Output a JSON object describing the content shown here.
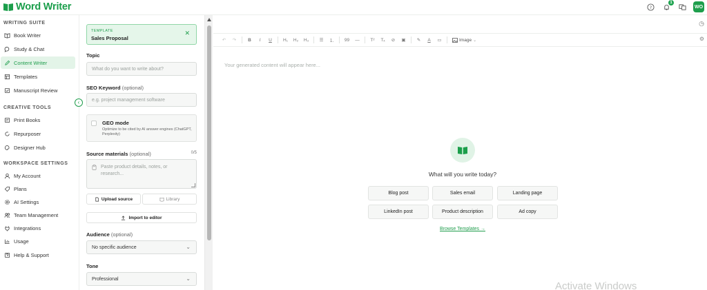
{
  "app": {
    "name": "Word Writer"
  },
  "topbar": {
    "notification_count": "1",
    "avatar_initials": "WO"
  },
  "sidebar": {
    "sections": [
      {
        "title": "WRITING SUITE",
        "items": [
          "Book Writer",
          "Study & Chat",
          "Content Writer",
          "Templates",
          "Manuscript Review"
        ]
      },
      {
        "title": "CREATIVE TOOLS",
        "items": [
          "Print Books",
          "Repurposer",
          "Designer Hub"
        ]
      },
      {
        "title": "WORKSPACE SETTINGS",
        "items": [
          "My Account",
          "Plans",
          "AI Settings",
          "Team Management",
          "Integrations",
          "Usage",
          "Help & Support"
        ]
      }
    ],
    "active_item": "Content Writer"
  },
  "form": {
    "template": {
      "label": "TEMPLATE",
      "name": "Sales Proposal"
    },
    "topic": {
      "label": "Topic",
      "placeholder": "What do you want to write about?"
    },
    "seo": {
      "label": "SEO Keyword",
      "optional": "(optional)",
      "placeholder": "e.g. project management software"
    },
    "geo": {
      "title": "GEO mode",
      "description": "Optimize to be cited by AI answer engines (ChatGPT, Perplexity)"
    },
    "sources": {
      "label": "Source materials",
      "optional": "(optional)",
      "count": "0/5",
      "placeholder": "Paste product details, notes, or research..."
    },
    "upload_label": "Upload source",
    "library_label": "Library",
    "import_label": "Import to editor",
    "audience": {
      "label": "Audience",
      "optional": "(optional)",
      "value": "No specific audience"
    },
    "tone": {
      "label": "Tone",
      "value": "Professional"
    }
  },
  "editor": {
    "toolbar": {
      "image_label": "Image"
    },
    "placeholder": "Your generated content will appear here...",
    "prompt": "What will you write today?",
    "quick_actions": [
      "Blog post",
      "Sales email",
      "Landing page",
      "LinkedIn post",
      "Product description",
      "Ad copy"
    ],
    "browse_label": "Browse Templates →"
  },
  "watermark": "Activate Windows",
  "colors": {
    "brand": "#1f9d4c",
    "active_bg": "#e3f4e8"
  }
}
